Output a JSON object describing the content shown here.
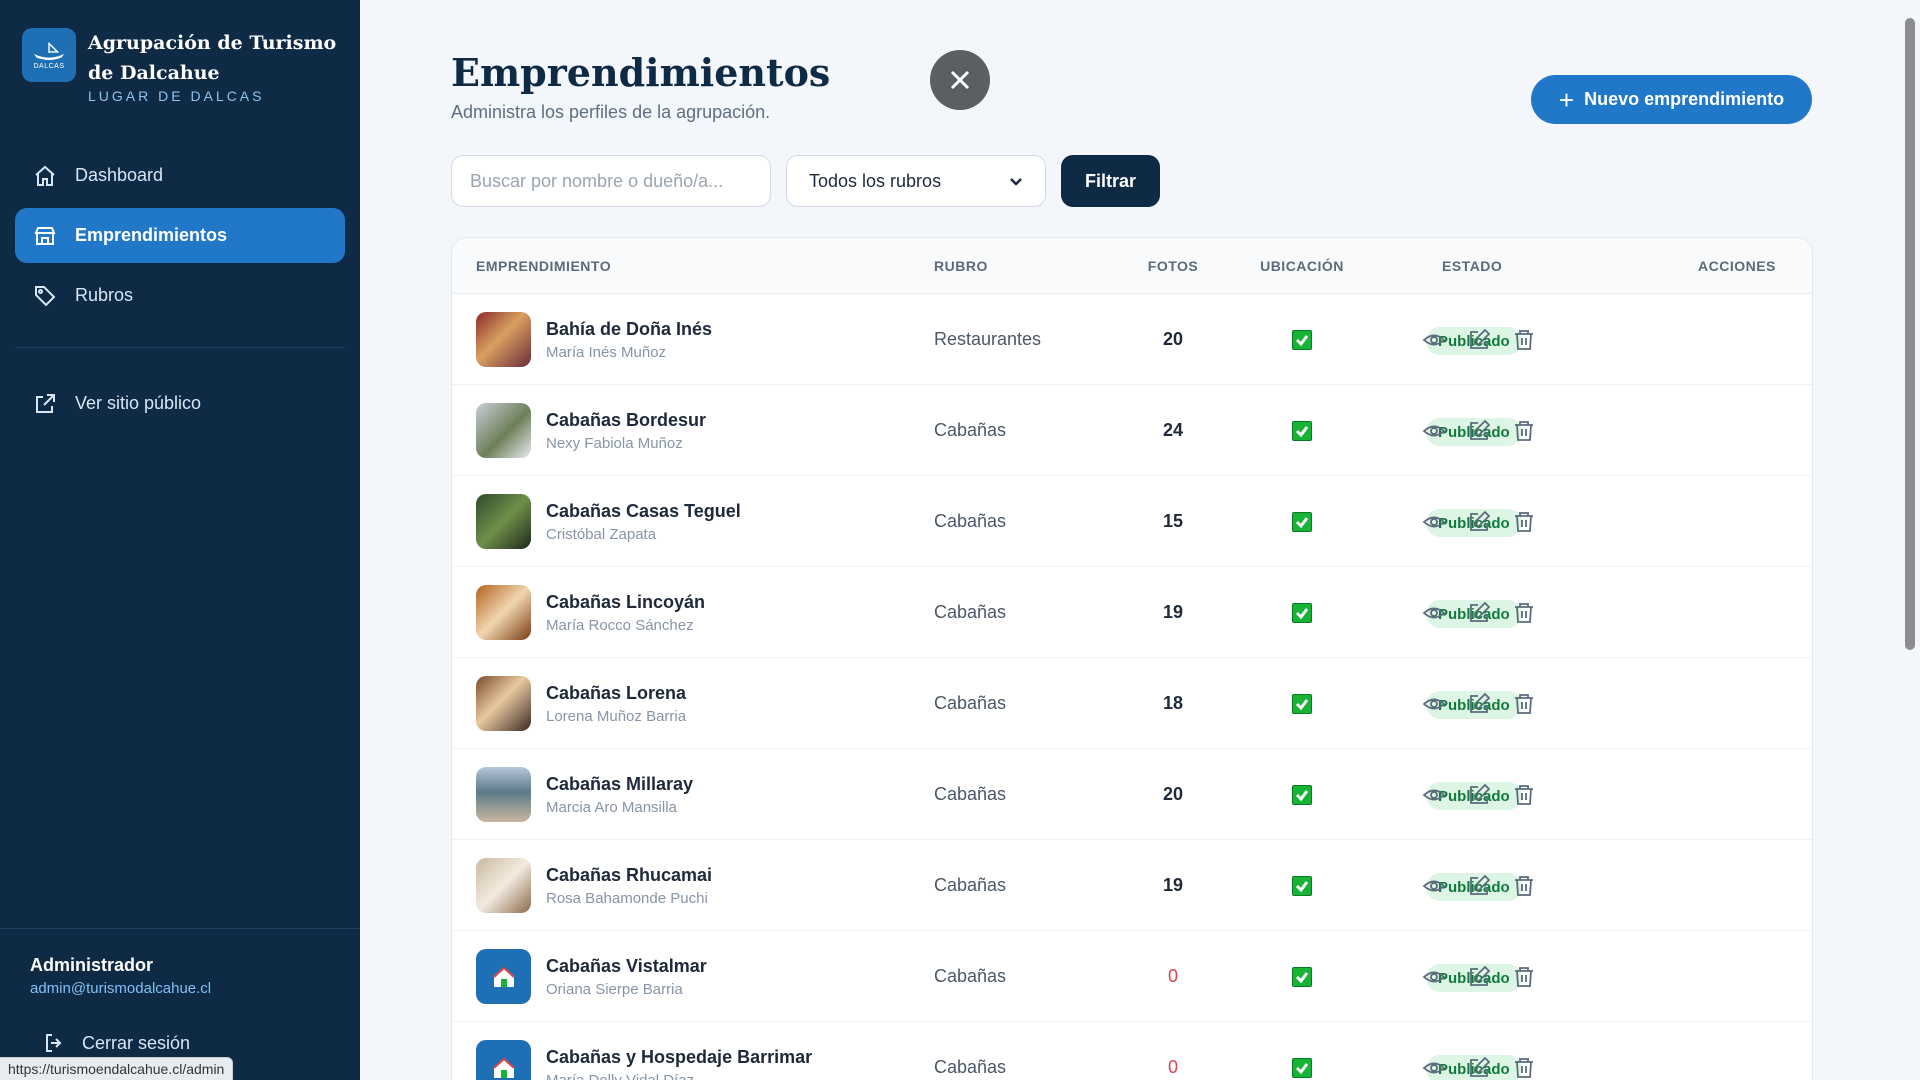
{
  "sidebar": {
    "brand_title": "Agrupación de Turismo de Dalcahue",
    "brand_subtitle": "LUGAR DE DALCAS",
    "logo_text": "DALCAS",
    "nav": [
      {
        "label": "Dashboard",
        "icon": "home-icon"
      },
      {
        "label": "Emprendimientos",
        "icon": "store-icon",
        "active": true
      },
      {
        "label": "Rubros",
        "icon": "tag-icon"
      }
    ],
    "public_site": {
      "label": "Ver sitio público",
      "icon": "external-link-icon"
    },
    "admin": {
      "name": "Administrador",
      "email": "admin@turismodalcahue.cl"
    },
    "logout_label": "Cerrar sesión"
  },
  "status_url": "https://turismoendalcahue.cl/admin",
  "header": {
    "title": "Emprendimientos",
    "subtitle": "Administra los perfiles de la agrupación.",
    "new_button": "Nuevo emprendimiento"
  },
  "filters": {
    "search_placeholder": "Buscar por nombre o dueño/a...",
    "rubro_selected": "Todos los rubros",
    "filter_button": "Filtrar"
  },
  "table": {
    "columns": [
      "EMPRENDIMIENTO",
      "RUBRO",
      "FOTOS",
      "UBICACIÓN",
      "ESTADO",
      "ACCIONES"
    ],
    "rows": [
      {
        "name": "Bahía de Doña Inés",
        "owner": "María Inés Muñoz",
        "rubro": "Restaurantes",
        "fotos": "20",
        "ubicacion": true,
        "estado": "Publicado"
      },
      {
        "name": "Cabañas Bordesur",
        "owner": "Nexy Fabiola Muñoz",
        "rubro": "Cabañas",
        "fotos": "24",
        "ubicacion": true,
        "estado": "Publicado"
      },
      {
        "name": "Cabañas Casas Teguel",
        "owner": "Cristóbal Zapata",
        "rubro": "Cabañas",
        "fotos": "15",
        "ubicacion": true,
        "estado": "Publicado"
      },
      {
        "name": "Cabañas Lincoyán",
        "owner": "María Rocco Sánchez",
        "rubro": "Cabañas",
        "fotos": "19",
        "ubicacion": true,
        "estado": "Publicado"
      },
      {
        "name": "Cabañas Lorena",
        "owner": "Lorena Muñoz Barria",
        "rubro": "Cabañas",
        "fotos": "18",
        "ubicacion": true,
        "estado": "Publicado"
      },
      {
        "name": "Cabañas Millaray",
        "owner": "Marcia Aro Mansilla",
        "rubro": "Cabañas",
        "fotos": "20",
        "ubicacion": true,
        "estado": "Publicado"
      },
      {
        "name": "Cabañas Rhucamai",
        "owner": "Rosa Bahamonde Puchi",
        "rubro": "Cabañas",
        "fotos": "19",
        "ubicacion": true,
        "estado": "Publicado"
      },
      {
        "name": "Cabañas Vistalmar",
        "owner": "Oriana Sierpe Barria",
        "rubro": "Cabañas",
        "fotos": "0",
        "ubicacion": true,
        "estado": "Publicado"
      },
      {
        "name": "Cabañas y Hospedaje Barrimar",
        "owner": "María Dolly Vidal Díaz",
        "rubro": "Cabañas",
        "fotos": "0",
        "ubicacion": true,
        "estado": "Publicado"
      }
    ]
  },
  "colors": {
    "sidebar_bg": "#0f2a45",
    "accent": "#2178c8",
    "published_badge_bg": "#dcf5e4",
    "published_badge_text": "#127a3c",
    "zero_photos": "#e0454a"
  }
}
